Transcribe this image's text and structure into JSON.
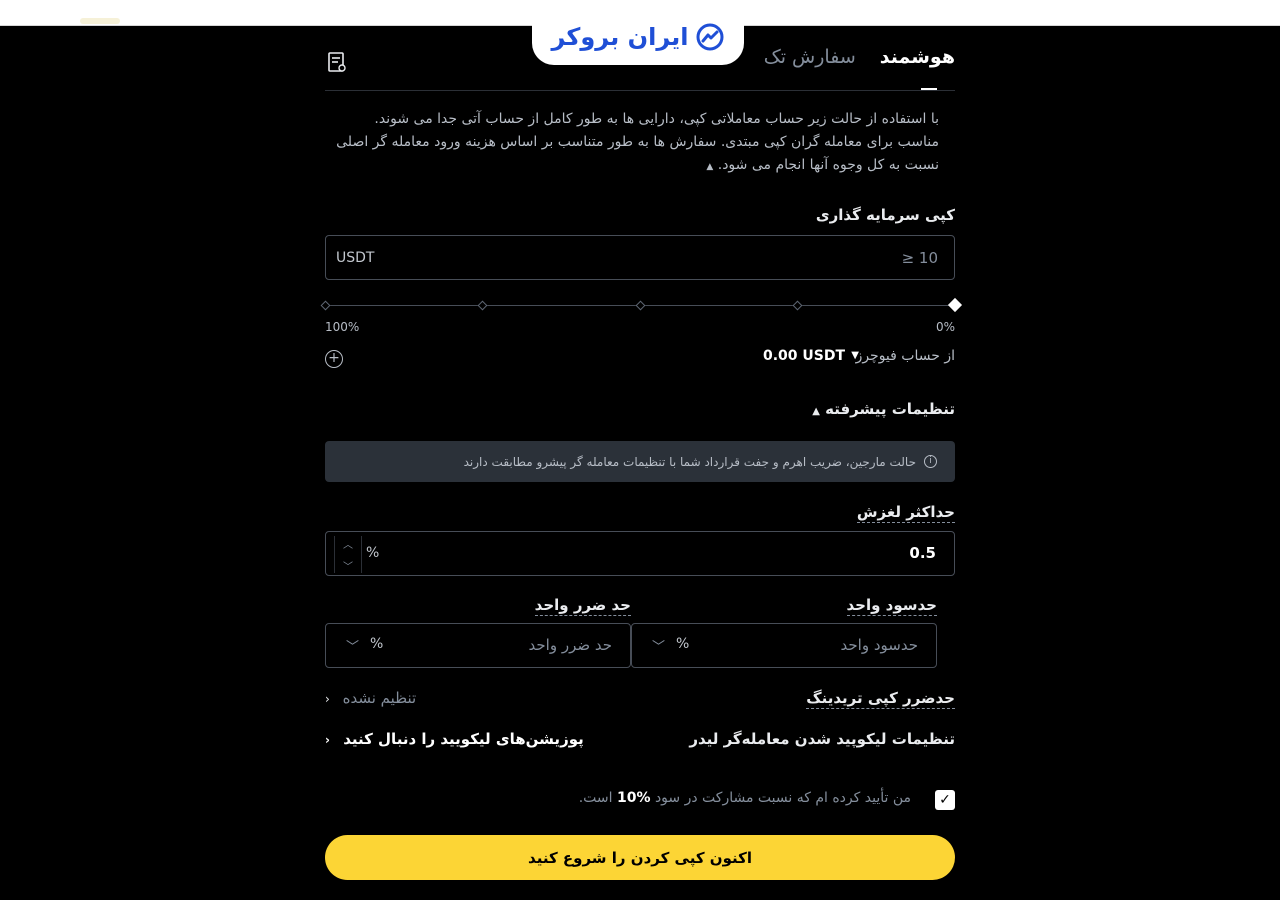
{
  "logo": {
    "text": "ایران بروکر"
  },
  "tabs": [
    {
      "label": "هوشمند"
    },
    {
      "label": "سفارش تک"
    }
  ],
  "info": {
    "text": "با استفاده از حالت زیر حساب معاملاتی کپی، دارایی ها به طور کامل از حساب آتی جدا می شوند. مناسب برای معامله گران کپی مبتدی. سفارش ها به طور متناسب بر اساس هزینه ورود معامله گر اصلی نسبت به کل وجوه آنها انجام می شود."
  },
  "investment": {
    "label": "کپی سرمایه گذاری",
    "placeholder": "≥ 10",
    "unit": "USDT",
    "slider_value_percent": 0,
    "slider_min_label": "0%",
    "slider_max_label": "100%"
  },
  "from_account": {
    "label": "از حساب فیوچرز",
    "value": "0.00 USDT"
  },
  "advanced": {
    "label": "تنظیمات پیشرفته",
    "notice": "حالت مارجین، ضریب اهرم و جفت قرارداد شما با تنظیمات معامله گر پیشرو مطابقت دارند"
  },
  "slippage": {
    "label": "حداکثر لغزش",
    "value": "0.5",
    "unit": "%"
  },
  "tp": {
    "label": "حدسود واحد",
    "placeholder": "حدسود واحد",
    "unit": "%"
  },
  "sl": {
    "label": "حد ضرر واحد",
    "placeholder": "حد ضرر واحد",
    "unit": "%"
  },
  "copy_stop": {
    "label": "حدضرر کپی تریدینگ",
    "value": "تنظیم نشده"
  },
  "liquidation": {
    "label": "تنظیمات لیکوپید شدن معامله‌گر لیدر",
    "value": "پوزیشن‌های لیکویید را دنبال کنید"
  },
  "confirm": {
    "text_before": "من تأیید کرده ام که نسبت مشارکت در سود",
    "percent": "10%",
    "text_after": "است.",
    "checked": true
  },
  "cta": {
    "label": "اکنون کپی کردن را شروع کنید"
  },
  "colors": {
    "accent": "#fcd535",
    "background": "#000000",
    "brand_blue": "#1f4fd6"
  }
}
